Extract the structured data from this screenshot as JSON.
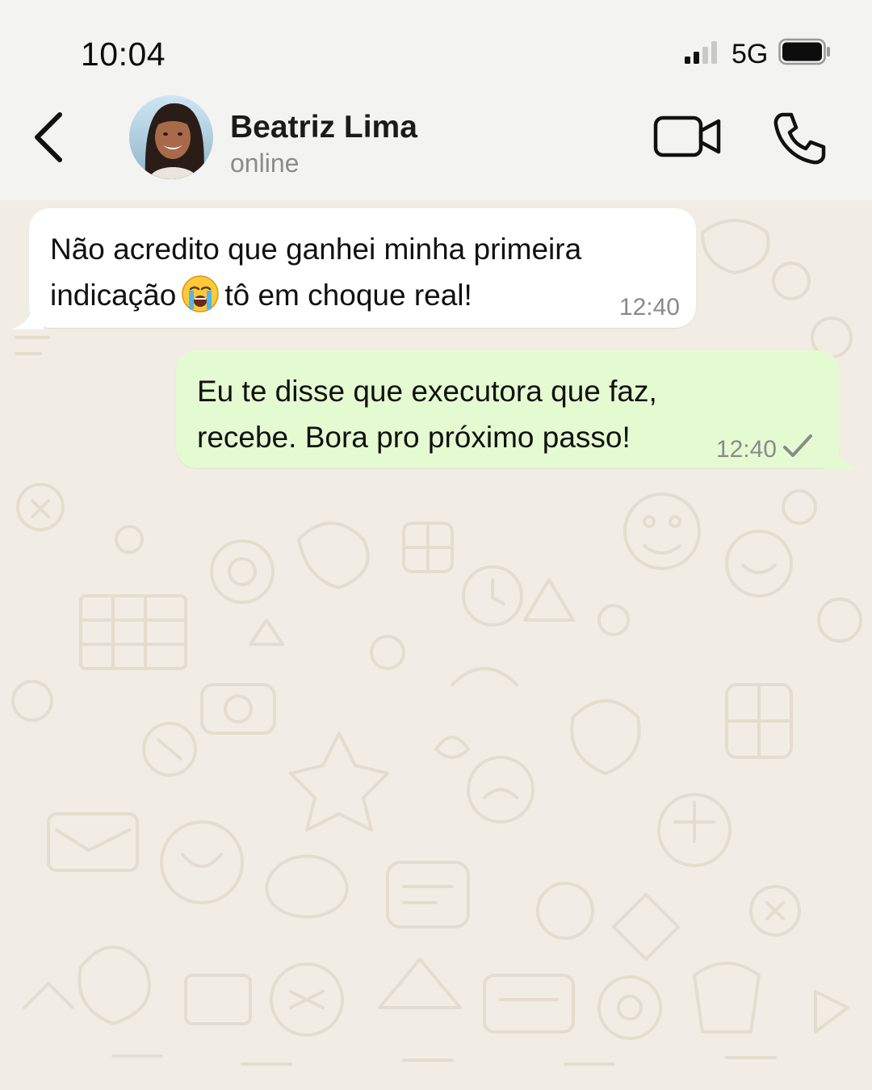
{
  "status_bar": {
    "time": "10:04",
    "network": "5G",
    "signal_bars": 2,
    "battery_icon": "battery-icon"
  },
  "header": {
    "back_icon": "chevron-left-icon",
    "contact_name": "Beatriz Lima",
    "contact_status": "online",
    "video_icon": "video-camera-icon",
    "call_icon": "phone-icon"
  },
  "messages": [
    {
      "direction": "incoming",
      "text_line1": "Não acredito que ganhei minha primeira",
      "text_line2a": "indicação",
      "emoji": "loudly-crying-face",
      "text_line2b": "tô em choque real!",
      "time": "12:40"
    },
    {
      "direction": "outgoing",
      "text_line1": "Eu te disse que executora que faz,",
      "text_line2": "recebe. Bora pro próximo passo!",
      "time": "12:40",
      "status_icon": "single-check-icon"
    }
  ],
  "colors": {
    "background": "#f3f3f1",
    "wallpaper": "#f1ede4",
    "incoming_bubble": "#ffffff",
    "outgoing_bubble": "#e4fbd1",
    "secondary_text": "#8a8a8a"
  }
}
